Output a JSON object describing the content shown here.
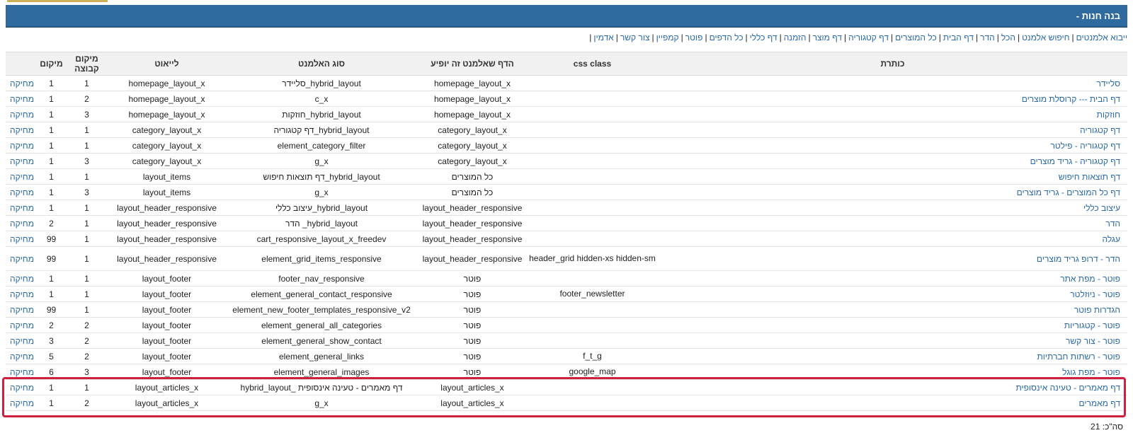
{
  "page": {
    "title": "בנה חנות -",
    "accent_color": "#2f6b9e",
    "link_color": "#2a6aa8",
    "highlight_color": "#d1203f"
  },
  "nav_links": [
    "ייבוא אלמנטים",
    "חיפוש אלמנט",
    "הכל",
    "הדר",
    "דף הבית",
    "כל המוצרים",
    "דף קטגוריה",
    "דף מוצר",
    "הזמנה",
    "דף כללי",
    "כל הדפים",
    "פוטר",
    "קמפיין",
    "צור קשר",
    "אדמין"
  ],
  "table": {
    "headers": {
      "title": "כותרת",
      "css_class": "css class",
      "page": "הדף שאלמנט זה יופיע",
      "element_type": "סוג האלמנט",
      "layout": "לייאוט",
      "group_position": "מיקום קבוצה",
      "position": "מיקום"
    },
    "rows": [
      {
        "title": "סליידר",
        "css": "",
        "page": "homepage_layout_x",
        "type": "hybrid_layout_סליידר",
        "layout": "homepage_layout_x",
        "group": "1",
        "pos": "1",
        "delete": "מחיקה"
      },
      {
        "title": "דף הבית --- קרוסלת מוצרים",
        "css": "",
        "page": "homepage_layout_x",
        "type": "c_x",
        "layout": "homepage_layout_x",
        "group": "2",
        "pos": "1",
        "delete": "מחיקה"
      },
      {
        "title": "חוזקות",
        "css": "",
        "page": "homepage_layout_x",
        "type": "hybrid_layout_חוזקות",
        "layout": "homepage_layout_x",
        "group": "3",
        "pos": "1",
        "delete": "מחיקה"
      },
      {
        "title": "דף קטגוריה",
        "css": "",
        "page": "category_layout_x",
        "type": "hybrid_layout_דף קטגוריה",
        "layout": "category_layout_x",
        "group": "1",
        "pos": "1",
        "delete": "מחיקה"
      },
      {
        "title": "דף קטגוריה - פילטר",
        "css": "",
        "page": "category_layout_x",
        "type": "element_category_filter",
        "layout": "category_layout_x",
        "group": "1",
        "pos": "1",
        "delete": "מחיקה"
      },
      {
        "title": "דף קטגוריה - גריד מוצרים",
        "css": "",
        "page": "category_layout_x",
        "type": "g_x",
        "layout": "category_layout_x",
        "group": "3",
        "pos": "1",
        "delete": "מחיקה"
      },
      {
        "title": "דף תוצאות חיפוש",
        "css": "",
        "page": "כל המוצרים",
        "type": "hybrid_layout_דף תוצאות חיפוש",
        "layout": "layout_items",
        "group": "1",
        "pos": "1",
        "delete": "מחיקה"
      },
      {
        "title": "דף כל המוצרים - גריד מוצרים",
        "css": "",
        "page": "כל המוצרים",
        "type": "g_x",
        "layout": "layout_items",
        "group": "3",
        "pos": "1",
        "delete": "מחיקה"
      },
      {
        "title": "עיצוב כללי",
        "css": "",
        "page": "layout_header_responsive",
        "type": "hybrid_layout_עיצוב כללי",
        "layout": "layout_header_responsive",
        "group": "1",
        "pos": "1",
        "delete": "מחיקה"
      },
      {
        "title": "הדר",
        "css": "",
        "page": "layout_header_responsive",
        "type": "hybrid_layout_ הדר",
        "layout": "layout_header_responsive",
        "group": "1",
        "pos": "2",
        "delete": "מחיקה"
      },
      {
        "title": "עגלה",
        "css": "",
        "page": "layout_header_responsive",
        "type": "cart_responsive_layout_x_freedev",
        "layout": "layout_header_responsive",
        "group": "1",
        "pos": "99",
        "delete": "מחיקה"
      },
      {
        "title": "הדר - דרופ גריד מוצרים",
        "css": "header_grid hidden-xs hidden-sm",
        "page": "layout_header_responsive",
        "type": "element_grid_items_responsive",
        "layout": "layout_header_responsive",
        "group": "1",
        "pos": "99",
        "delete": "מחיקה"
      },
      {
        "title": "פוטר - מפת אתר",
        "css": "",
        "page": "פוטר",
        "type": "footer_nav_responsive",
        "layout": "layout_footer",
        "group": "1",
        "pos": "1",
        "delete": "מחיקה"
      },
      {
        "title": "פוטר - ניוזלטר",
        "css": "footer_newsletter",
        "page": "פוטר",
        "type": "element_general_contact_responsive",
        "layout": "layout_footer",
        "group": "1",
        "pos": "1",
        "delete": "מחיקה"
      },
      {
        "title": "הגדרות פוטר",
        "css": "",
        "page": "פוטר",
        "type": "element_new_footer_templates_responsive_v2",
        "layout": "layout_footer",
        "group": "1",
        "pos": "99",
        "delete": "מחיקה"
      },
      {
        "title": "פוטר - קטגוריות",
        "css": "",
        "page": "פוטר",
        "type": "element_general_all_categories",
        "layout": "layout_footer",
        "group": "2",
        "pos": "2",
        "delete": "מחיקה"
      },
      {
        "title": "פוטר - צור קשר",
        "css": "",
        "page": "פוטר",
        "type": "element_general_show_contact",
        "layout": "layout_footer",
        "group": "2",
        "pos": "3",
        "delete": "מחיקה"
      },
      {
        "title": "פוטר - רשתות חברתיות",
        "css": "f_t_g",
        "page": "פוטר",
        "type": "element_general_links",
        "layout": "layout_footer",
        "group": "2",
        "pos": "5",
        "delete": "מחיקה"
      },
      {
        "title": "פוטר - מפת גוגל",
        "css": "google_map",
        "page": "פוטר",
        "type": "element_general_images",
        "layout": "layout_footer",
        "group": "3",
        "pos": "6",
        "delete": "מחיקה"
      },
      {
        "title": "דף מאמרים - טעינה אינסופית",
        "css": "",
        "page": "layout_articles_x",
        "type": "דף מאמרים - טעינה אינסופית _hybrid_layout",
        "layout": "layout_articles_x",
        "group": "1",
        "pos": "1",
        "delete": "מחיקה"
      },
      {
        "title": "דף מאמרים",
        "css": "",
        "page": "layout_articles_x",
        "type": "g_x",
        "layout": "layout_articles_x",
        "group": "2",
        "pos": "1",
        "delete": "מחיקה"
      }
    ]
  },
  "total": "סה\"כ: 21"
}
